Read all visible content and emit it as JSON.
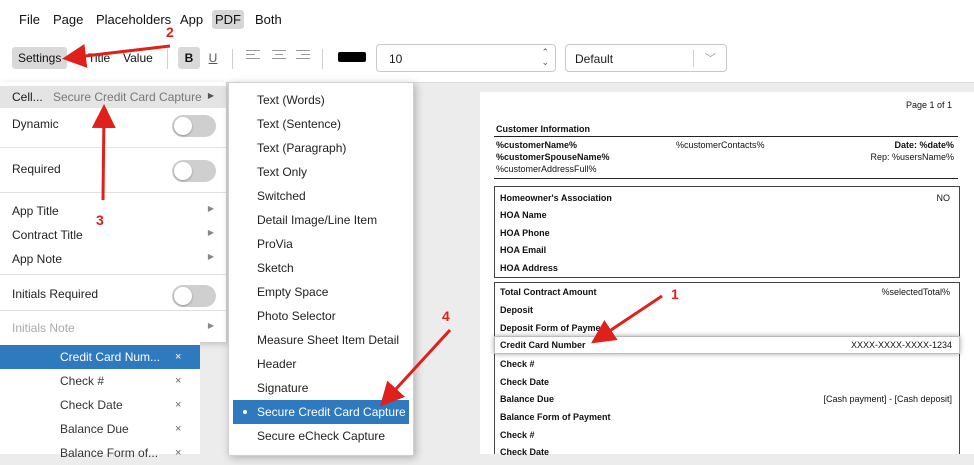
{
  "menubar": {
    "items": [
      "File",
      "Page",
      "Placeholders",
      "App",
      "PDF",
      "Both"
    ]
  },
  "toolbar": {
    "settings": "Settings",
    "title": "Title",
    "value": "Value",
    "bold": "B",
    "underline": "U",
    "font_size": "10",
    "font_name": "Default"
  },
  "leftmenu": {
    "cell_label": "Cell...",
    "cell_value": "Secure Credit Card Capture",
    "dynamic": "Dynamic",
    "required": "Required",
    "app_title": "App Title",
    "contract_title": "Contract Title",
    "app_note": "App Note",
    "initials_required": "Initials Required",
    "initials_note": "Initials Note"
  },
  "bluelist": {
    "items": [
      {
        "label": "Credit Card Num...",
        "x": "×"
      },
      {
        "label": "Check #",
        "x": "×"
      },
      {
        "label": "Check Date",
        "x": "×"
      },
      {
        "label": "Balance Due",
        "x": "×"
      },
      {
        "label": "Balance Form of...",
        "x": "×"
      }
    ]
  },
  "submenu": {
    "items": [
      "Text (Words)",
      "Text (Sentence)",
      "Text (Paragraph)",
      "Text Only",
      "Switched",
      "Detail Image/Line Item",
      "ProVia",
      "Sketch",
      "Empty Space",
      "Photo Selector",
      "Measure Sheet Item Detail",
      "Header",
      "Signature",
      "Secure Credit Card Capture",
      "Secure eCheck Capture"
    ],
    "selected_index": 13
  },
  "document": {
    "page": "Page 1 of 1",
    "customer_info": "Customer Information",
    "customer_name": "%customerName%",
    "customer_contacts": "%customerContacts%",
    "date": "Date: %date%",
    "spouse": "%customerSpouseName%",
    "rep": "Rep: %usersName%",
    "address": "%customerAddressFull%",
    "hoa": "Homeowner's Association",
    "hoa_value": "NO",
    "hoa_name": "HOA Name",
    "hoa_phone": "HOA Phone",
    "hoa_email": "HOA Email",
    "hoa_address": "HOA Address",
    "total": "Total Contract Amount",
    "total_value": "%selectedTotal%",
    "deposit": "Deposit",
    "deposit_form": "Deposit Form of Payme",
    "cc_number": "Credit Card Number",
    "cc_value": "XXXX-XXXX-XXXX-1234",
    "check": "Check #",
    "check_date": "Check Date",
    "balance_due": "Balance Due",
    "balance_value": "[Cash payment] - [Cash deposit]",
    "balance_form": "Balance Form of Payment",
    "check2": "Check #",
    "check_date2": "Check Date"
  },
  "annotations": {
    "n1": "1",
    "n2": "2",
    "n3": "3",
    "n4": "4"
  },
  "colors": {
    "selection": "#2f79be",
    "annotation": "#e0201b"
  }
}
